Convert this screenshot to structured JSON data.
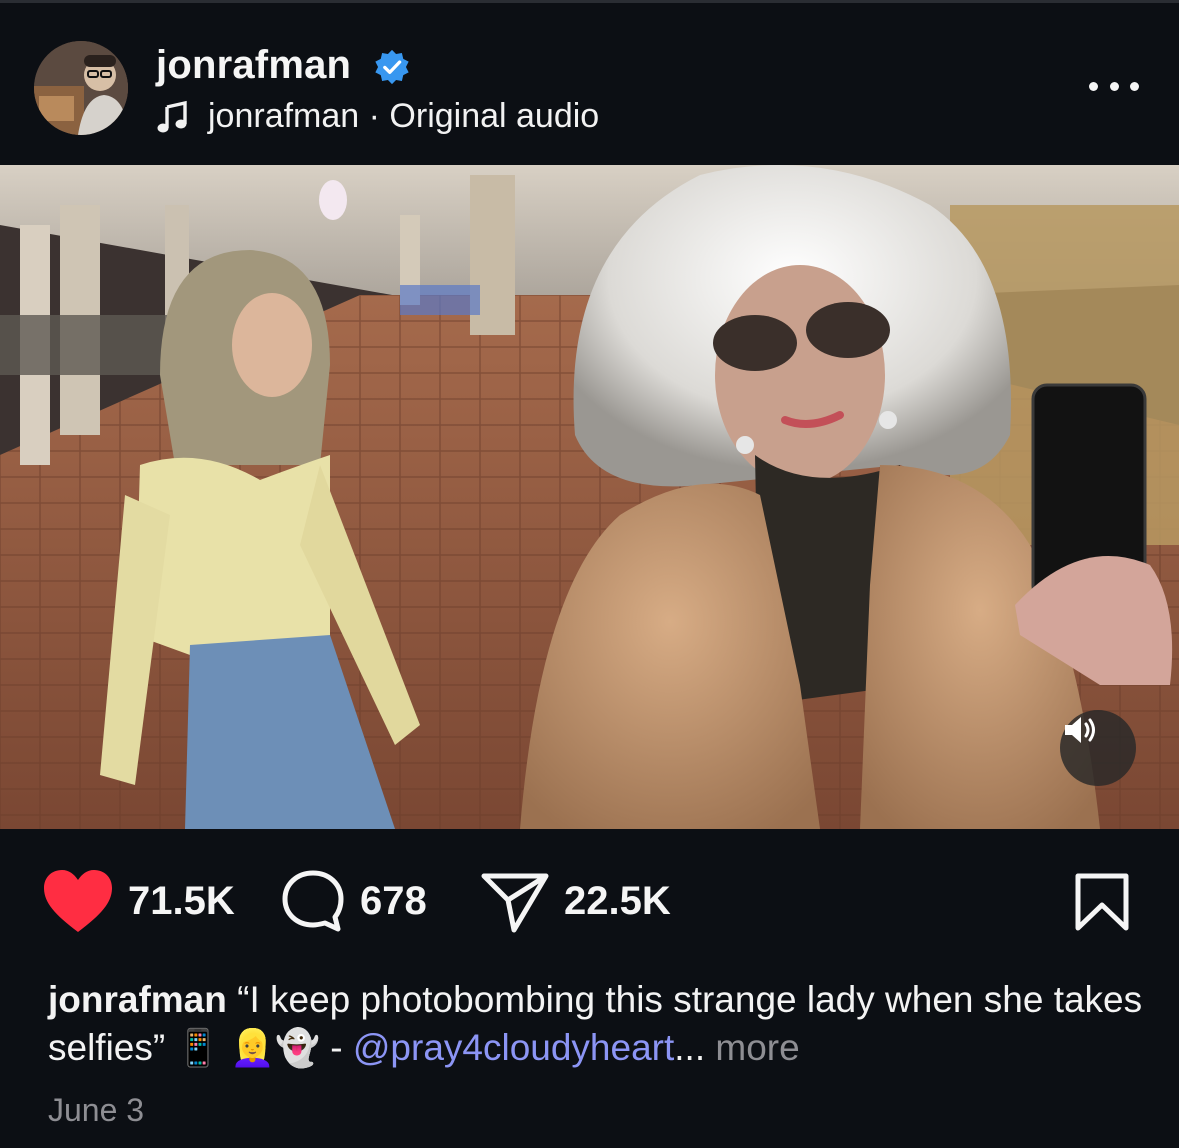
{
  "header": {
    "username": "jonrafman",
    "audio_owner": "jonrafman",
    "audio_separator": " · ",
    "audio_label": "Original audio"
  },
  "media": {
    "type": "video",
    "sound_icon": "speaker-icon"
  },
  "actions": {
    "likes": "71.5K",
    "comments": "678",
    "shares": "22.5K"
  },
  "caption": {
    "username": "jonrafman",
    "text": " “I keep photobombing this strange lady when she takes selfies” ",
    "emojis": "📱 👱‍♀️👻",
    "dash": " - ",
    "mention": "@pray4cloudyheart",
    "ellipsis": "...",
    "more": " more"
  },
  "date": "June 3",
  "colors": {
    "background": "#0c0f14",
    "heart": "#ff2d42",
    "verified": "#3897f0",
    "mention": "#8c95f5",
    "muted": "#8e8e93"
  }
}
